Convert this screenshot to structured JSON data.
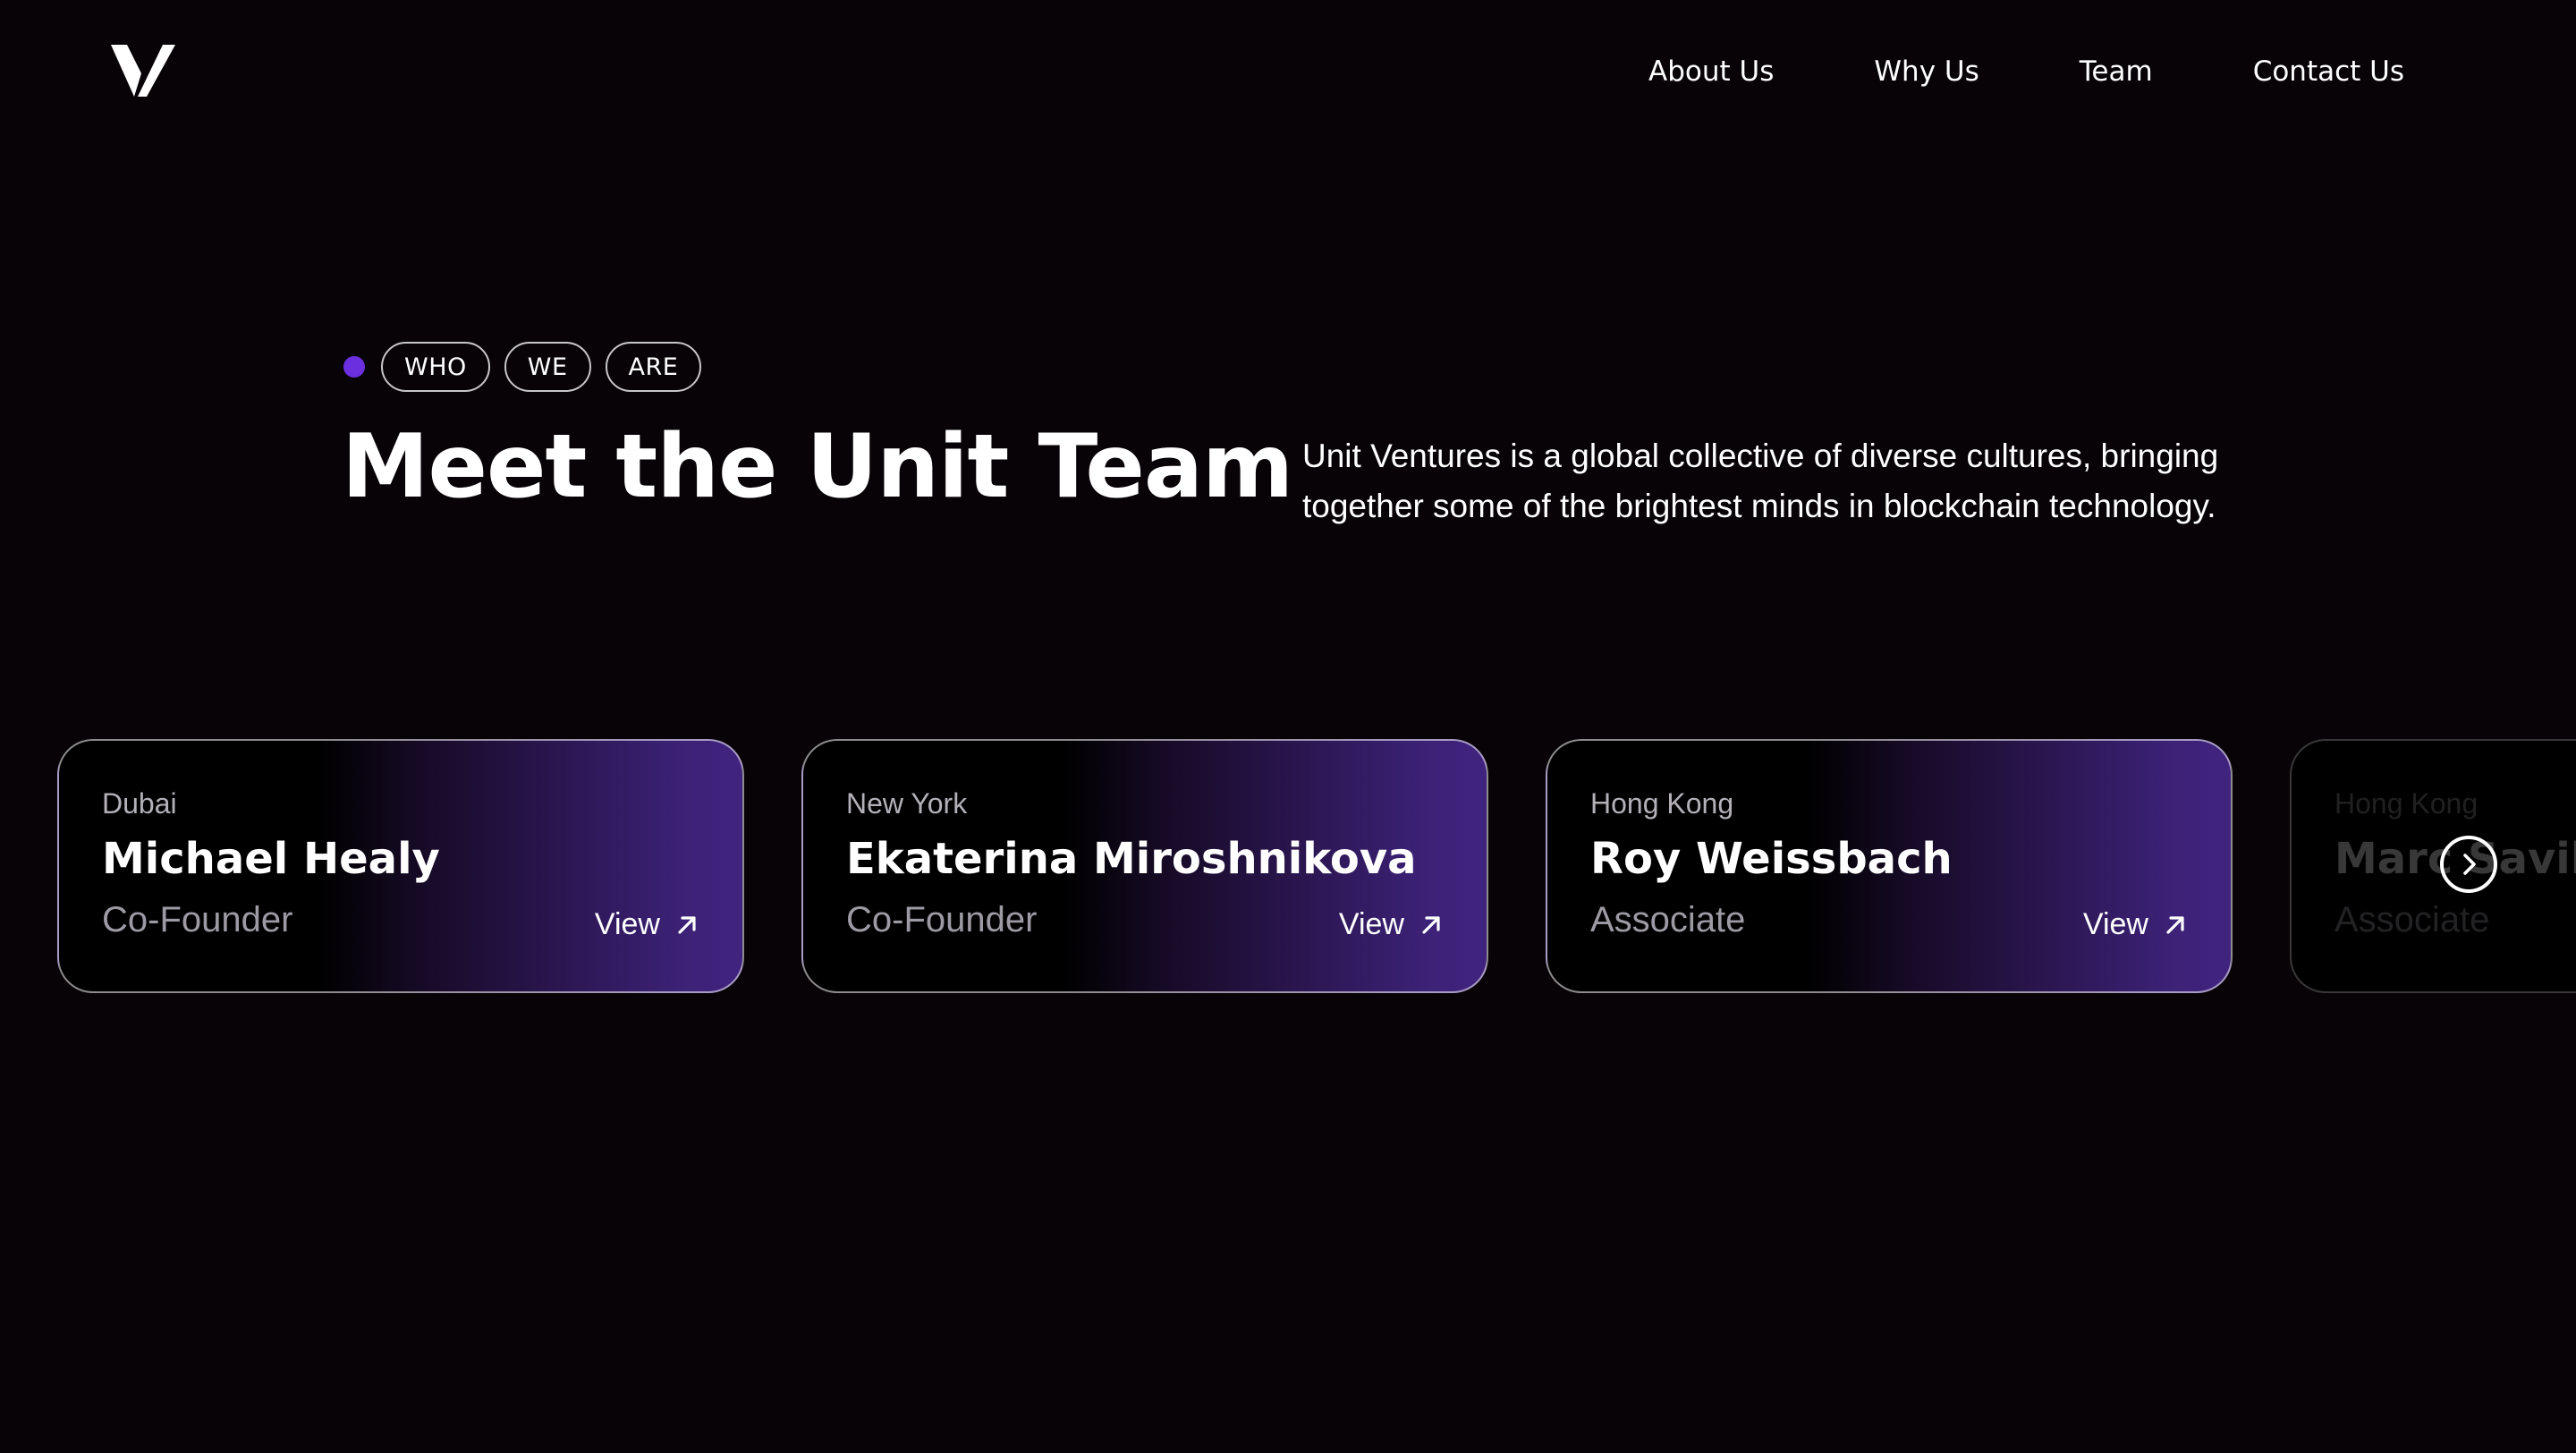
{
  "header": {
    "logo": "unit-ventures-logo-icon",
    "nav": [
      "About Us",
      "Why Us",
      "Team",
      "Contact Us"
    ]
  },
  "hero": {
    "eyebrow": [
      "WHO",
      "WE",
      "ARE"
    ],
    "title": "Meet the Unit Team",
    "description": "Unit Ventures is a global collective of diverse cultures, bringing together some of the brightest minds in blockchain technology."
  },
  "cards": [
    {
      "city": "Dubai",
      "name": "Michael Healy",
      "role": "Co-Founder",
      "view_label": "View"
    },
    {
      "city": "New York",
      "name": "Ekaterina Miroshnikova",
      "role": "Co-Founder",
      "view_label": "View"
    },
    {
      "city": "Hong Kong",
      "name": "Roy Weissbach",
      "role": "Associate",
      "view_label": "View"
    },
    {
      "city": "Hong Kong",
      "name": "Marc Savil",
      "role": "Associate"
    }
  ],
  "colors": {
    "background": "#080306",
    "accent": "#6b2fe0",
    "card_gradient_end": "#40237e"
  }
}
